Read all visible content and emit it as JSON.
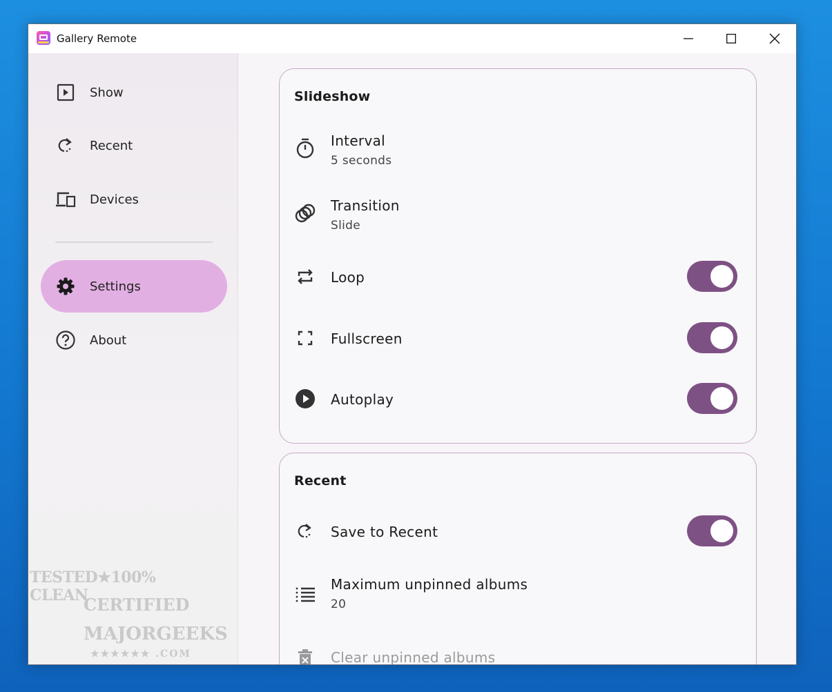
{
  "window": {
    "title": "Gallery Remote"
  },
  "sidebar": {
    "items": [
      {
        "label": "Show",
        "icon": "play-square-icon"
      },
      {
        "label": "Recent",
        "icon": "redo-icon"
      },
      {
        "label": "Devices",
        "icon": "devices-icon"
      },
      {
        "label": "Settings",
        "icon": "gear-icon",
        "active": true
      },
      {
        "label": "About",
        "icon": "help-circle-icon"
      }
    ]
  },
  "watermark": {
    "line1": "TESTED★100% CLEAN",
    "line2": "CERTIFIED",
    "line3": "MAJORGEEKS",
    "line4": "★★★★★★ .COM"
  },
  "slideshow": {
    "title": "Slideshow",
    "interval": {
      "label": "Interval",
      "value": "5 seconds",
      "icon": "timer-icon"
    },
    "transition": {
      "label": "Transition",
      "value": "Slide",
      "icon": "transition-icon"
    },
    "loop": {
      "label": "Loop",
      "on": true,
      "icon": "repeat-icon"
    },
    "fullscreen": {
      "label": "Fullscreen",
      "on": true,
      "icon": "fullscreen-icon"
    },
    "autoplay": {
      "label": "Autoplay",
      "on": true,
      "icon": "play-circle-icon"
    }
  },
  "recent": {
    "title": "Recent",
    "save_to_recent": {
      "label": "Save to Recent",
      "on": true,
      "icon": "redo-icon"
    },
    "max_unpinned": {
      "label": "Maximum unpinned albums",
      "value": "20",
      "icon": "list-numbered-icon"
    },
    "clear_unpinned": {
      "label": "Clear unpinned albums",
      "icon": "delete-icon"
    }
  },
  "colors": {
    "accent": "#7e5184",
    "active_nav": "#e2afe3",
    "card_border": "#c8a9c7",
    "desktop": "#1378d0"
  }
}
